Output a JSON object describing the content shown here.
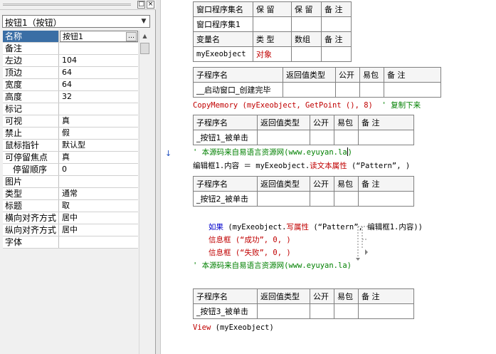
{
  "property_panel": {
    "object_selector": "按钮1（按钮）",
    "rows": [
      {
        "name": "名称",
        "value": "按钮1",
        "selected": true,
        "boxed": true,
        "has_button": true
      },
      {
        "name": "备注",
        "value": ""
      },
      {
        "name": "左边",
        "value": "104"
      },
      {
        "name": "顶边",
        "value": "64"
      },
      {
        "name": "宽度",
        "value": "64"
      },
      {
        "name": "高度",
        "value": "32"
      },
      {
        "name": "标记",
        "value": ""
      },
      {
        "name": "可视",
        "value": "真"
      },
      {
        "name": "禁止",
        "value": "假"
      },
      {
        "name": "鼠标指针",
        "value": "默认型"
      },
      {
        "name": "可停留焦点",
        "value": "真"
      },
      {
        "name": "停留顺序",
        "value": "0",
        "indent": true
      },
      {
        "name": "图片",
        "value": ""
      },
      {
        "name": "类型",
        "value": "通常"
      },
      {
        "name": "标题",
        "value": "取"
      },
      {
        "name": "横向对齐方式",
        "value": "居中"
      },
      {
        "name": "纵向对齐方式",
        "value": "居中"
      },
      {
        "name": "字体",
        "value": ""
      }
    ]
  },
  "code": {
    "assembly_table": {
      "headers": [
        "窗口程序集名",
        "保 留",
        "保 留",
        "备 注"
      ],
      "row": [
        "窗口程序集1",
        "",
        "",
        ""
      ]
    },
    "var_table": {
      "headers": [
        "变量名",
        "类 型",
        "数组",
        "备 注"
      ],
      "row": [
        "myExeobject",
        "对象",
        "",
        ""
      ]
    },
    "sub1_table": {
      "headers": [
        "子程序名",
        "返回值类型",
        "公开",
        "易包",
        "备 注"
      ],
      "row": [
        "__启动窗口_创建完毕",
        "",
        "",
        "",
        ""
      ]
    },
    "line_copymemory": {
      "fn": "CopyMemory",
      "args": " (myExeobject, GetPoint (), 8)",
      "comment": "  ' 复制下来"
    },
    "sub2_table": {
      "headers": [
        "子程序名",
        "返回值类型",
        "公开",
        "易包",
        "备 注"
      ],
      "row": [
        "_按钮1_被单击",
        "",
        "",
        "",
        ""
      ]
    },
    "comment1": "' 本源码来自易语言资源网(www.eyuyan.la",
    "comment1_end": ")",
    "line_assign": {
      "lhs": "编辑框1.内容 ＝ myExeobject.",
      "method": "读文本属性",
      "args": " (“Pattern”, )"
    },
    "sub3_table": {
      "headers": [
        "子程序名",
        "返回值类型",
        "公开",
        "易包",
        "备 注"
      ],
      "row": [
        "_按钮2_被单击",
        "",
        "",
        "",
        ""
      ]
    },
    "if_line": {
      "keyword": "如果",
      "pre": " (myExeobject.",
      "method": "写属性",
      "post": " (“Pattern”, 编辑框1.内容))"
    },
    "msg_success": {
      "fn": "信息框",
      "args": " (“成功”, 0, )"
    },
    "msg_fail": {
      "fn": "信息框",
      "args": " (“失败”, 0, )"
    },
    "comment2": "' 本源码来自易语言资源网(www.eyuyan.la)",
    "sub4_table": {
      "headers": [
        "子程序名",
        "返回值类型",
        "公开",
        "易包",
        "备 注"
      ],
      "row": [
        "_按钮3_被单击",
        "",
        "",
        "",
        ""
      ]
    },
    "line_view": {
      "fn": "View",
      "args": " (myExeobject)"
    }
  }
}
